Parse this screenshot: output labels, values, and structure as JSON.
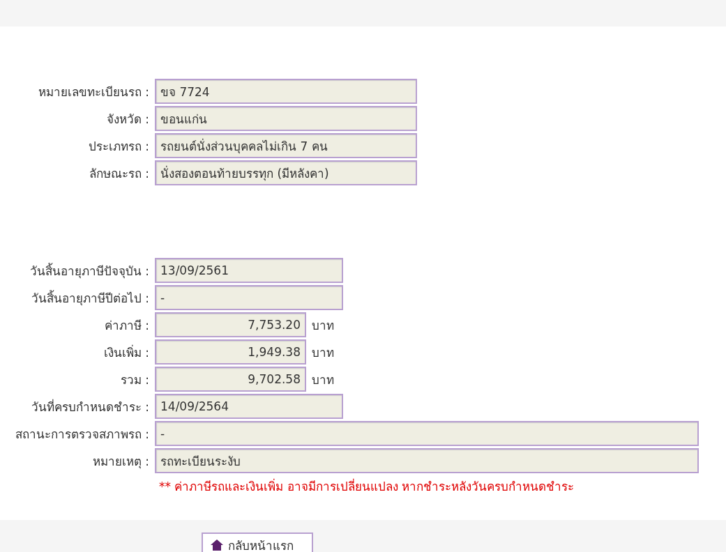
{
  "vehicle": [
    {
      "label": "หมายเลขทะเบียนรถ :",
      "value": "ขจ 7724",
      "kind": "wide"
    },
    {
      "label": "จังหวัด :",
      "value": "ขอนแก่น",
      "kind": "wide"
    },
    {
      "label": "ประเภทรถ :",
      "value": "รถยนต์นั่งส่วนบุคคลไม่เกิน 7 คน",
      "kind": "wide"
    },
    {
      "label": "ลักษณะรถ :",
      "value": "นั่งสองตอนท้ายบรรทุก (มีหลังคา)",
      "kind": "wide"
    }
  ],
  "tax": [
    {
      "label": "วันสิ้นอายุภาษีปัจจุบัน :",
      "value": "13/09/2561",
      "kind": "medium"
    },
    {
      "label": "วันสิ้นอายุภาษีปีต่อไป :",
      "value": "-",
      "kind": "medium"
    },
    {
      "label": "ค่าภาษี :",
      "value": "7,753.20",
      "kind": "money",
      "unit": "บาท"
    },
    {
      "label": "เงินเพิ่ม :",
      "value": "1,949.38",
      "kind": "money",
      "unit": "บาท"
    },
    {
      "label": "รวม :",
      "value": "9,702.58",
      "kind": "money",
      "unit": "บาท"
    },
    {
      "label": "วันที่ครบกำหนดชำระ :",
      "value": "14/09/2564",
      "kind": "medium"
    },
    {
      "label": "สถานะการตรวจสภาพรถ :",
      "value": "-",
      "kind": "full"
    },
    {
      "label": "หมายเหตุ :",
      "value": "รถทะเบียนระงับ",
      "kind": "full"
    }
  ],
  "notice": "** ค่าภาษีรถและเงินเพิ่ม อาจมีการเปลี่ยนแปลง หากชำระหลังวันครบกำหนดชำระ",
  "home_button": "กลับหน้าแรก"
}
